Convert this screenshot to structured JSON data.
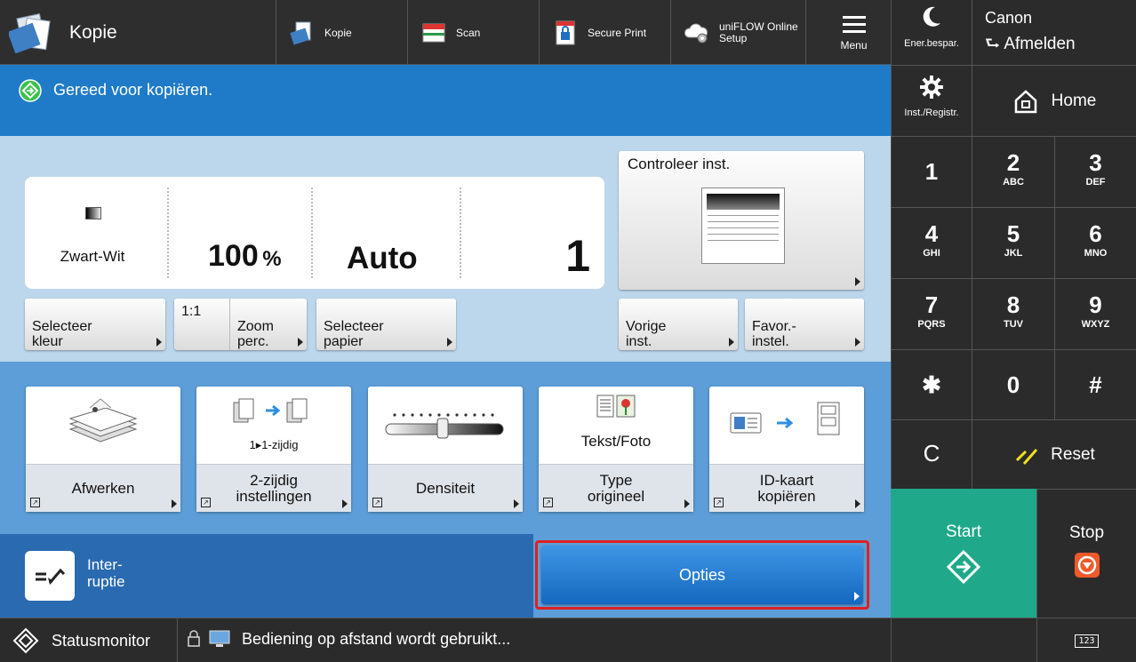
{
  "header": {
    "app_title": "Kopie",
    "shortcuts": [
      {
        "label": "Kopie"
      },
      {
        "label": "Scan"
      },
      {
        "label": "Secure Print"
      },
      {
        "label1": "uniFLOW Online",
        "label2": "Setup"
      }
    ],
    "menu_label": "Menu"
  },
  "right_panel": {
    "energy_label": "Ener.bespar.",
    "user_name": "Canon",
    "logout_label": "Afmelden",
    "settings_label": "Inst./Registr.",
    "home_label": "Home",
    "keys": [
      {
        "n": "1",
        "l": ""
      },
      {
        "n": "2",
        "l": "ABC"
      },
      {
        "n": "3",
        "l": "DEF"
      },
      {
        "n": "4",
        "l": "GHI"
      },
      {
        "n": "5",
        "l": "JKL"
      },
      {
        "n": "6",
        "l": "MNO"
      },
      {
        "n": "7",
        "l": "PQRS"
      },
      {
        "n": "8",
        "l": "TUV"
      },
      {
        "n": "9",
        "l": "WXYZ"
      },
      {
        "n": "✱",
        "l": ""
      },
      {
        "n": "0",
        "l": ""
      },
      {
        "n": "#",
        "l": ""
      }
    ],
    "clear_label": "C",
    "reset_label": "Reset",
    "start_label": "Start",
    "stop_label": "Stop"
  },
  "status": {
    "message": "Gereed voor kopiëren."
  },
  "summary": {
    "color_mode": "Zwart-Wit",
    "zoom_value": "100",
    "zoom_unit": "%",
    "paper": "Auto",
    "copies": "1",
    "check_label": "Controleer inst."
  },
  "setting_buttons": {
    "select_color": "Selecteer\nkleur",
    "one_to_one": "1:1",
    "zoom": "Zoom\nperc.",
    "select_paper": "Selecteer\npapier",
    "previous": "Vorige\ninst.",
    "favorites": "Favor.-\ninstel."
  },
  "functions": [
    {
      "sub": "",
      "label": "Afwerken"
    },
    {
      "sub": "1▸1-zijdig",
      "label": "2-zijdig\ninstellingen"
    },
    {
      "sub": "",
      "label": "Densiteit"
    },
    {
      "sub": "Tekst/Foto",
      "label": "Type\norigineel"
    },
    {
      "sub": "",
      "label": "ID-kaart\nkopiëren"
    }
  ],
  "interrupt_label": "Inter-\nruptie",
  "options_label": "Opties",
  "footer": {
    "status_monitor": "Statusmonitor",
    "remote_message": "Bediening op afstand wordt gebruikt...",
    "keyboard_label": "123"
  },
  "colors": {
    "status_blue": "#1f7bc8",
    "settings_bg": "#bcd6ec",
    "functions_bg": "#5d9ed8",
    "start_green": "#1fa98a",
    "stop_orange": "#f05a2a",
    "highlight_red": "#e02020"
  }
}
